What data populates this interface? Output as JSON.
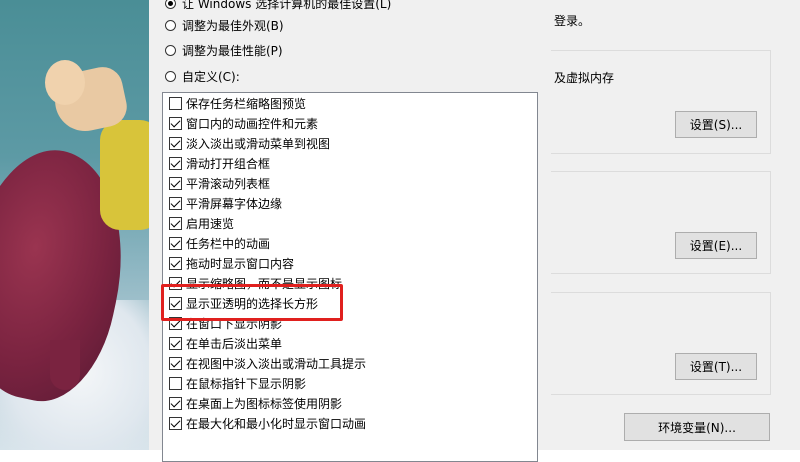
{
  "radio_options": [
    {
      "label": "让 Windows 选择计算机的最佳设置(L)",
      "checked": true
    },
    {
      "label": "调整为最佳外观(B)",
      "checked": false
    },
    {
      "label": "调整为最佳性能(P)",
      "checked": false
    },
    {
      "label": "自定义(C):",
      "checked": false
    }
  ],
  "effects": [
    {
      "label": "保存任务栏缩略图预览",
      "checked": false
    },
    {
      "label": "窗口内的动画控件和元素",
      "checked": true
    },
    {
      "label": "淡入淡出或滑动菜单到视图",
      "checked": true
    },
    {
      "label": "滑动打开组合框",
      "checked": true
    },
    {
      "label": "平滑滚动列表框",
      "checked": true
    },
    {
      "label": "平滑屏幕字体边缘",
      "checked": true
    },
    {
      "label": "启用速览",
      "checked": true
    },
    {
      "label": "任务栏中的动画",
      "checked": true
    },
    {
      "label": "拖动时显示窗口内容",
      "checked": true
    },
    {
      "label": "显示缩略图，而不是显示图标",
      "checked": true
    },
    {
      "label": "显示亚透明的选择长方形",
      "checked": true
    },
    {
      "label": "在窗口下显示阴影",
      "checked": true
    },
    {
      "label": "在单击后淡出菜单",
      "checked": true
    },
    {
      "label": "在视图中淡入淡出或滑动工具提示",
      "checked": true
    },
    {
      "label": "在鼠标指针下显示阴影",
      "checked": false
    },
    {
      "label": "在桌面上为图标标签使用阴影",
      "checked": true
    },
    {
      "label": "在最大化和最小化时显示窗口动画",
      "checked": true
    }
  ],
  "right_panel": {
    "login_note": "登录。",
    "performance_desc": "及虚拟内存",
    "settings_s": "设置(S)...",
    "settings_e": "设置(E)...",
    "settings_t": "设置(T)...",
    "env_vars": "环境变量(N)..."
  },
  "colors": {
    "highlight": "#e0201e",
    "dialog_bg": "#f0f0f0"
  }
}
